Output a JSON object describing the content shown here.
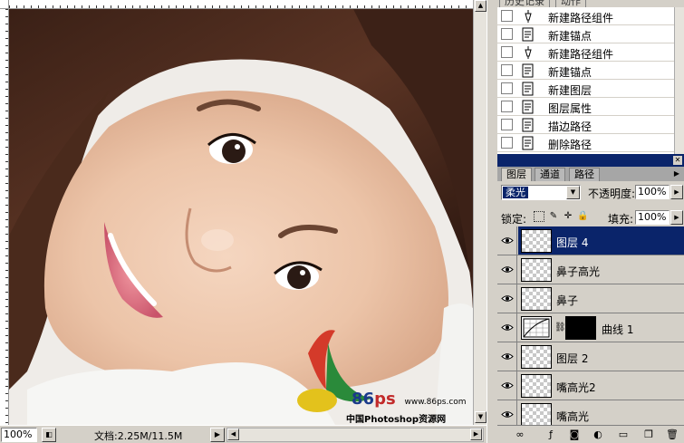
{
  "canvas": {
    "watermark": {
      "brand_number": "86",
      "brand_letters": "ps",
      "url": "www.86ps.com",
      "site_name": "中国Photoshop资源网"
    }
  },
  "statusbar": {
    "zoom": "100%",
    "doc_info": "文档:2.25M/11.5M"
  },
  "history_panel": {
    "tabs": [
      "历史记录",
      "动作"
    ],
    "items": [
      {
        "label": "新建路径组件",
        "icon": "pen-icon"
      },
      {
        "label": "新建锚点",
        "icon": "history-state-icon"
      },
      {
        "label": "新建路径组件",
        "icon": "pen-icon"
      },
      {
        "label": "新建锚点",
        "icon": "history-state-icon"
      },
      {
        "label": "新建图层",
        "icon": "history-state-icon"
      },
      {
        "label": "图层属性",
        "icon": "history-state-icon"
      },
      {
        "label": "描边路径",
        "icon": "history-state-icon"
      },
      {
        "label": "删除路径",
        "icon": "history-state-icon"
      }
    ]
  },
  "layers_panel": {
    "tabs": [
      "图层",
      "通道",
      "路径"
    ],
    "blend_mode": "柔光",
    "opacity_label": "不透明度:",
    "opacity_value": "100%",
    "lock_label": "锁定:",
    "fill_label": "填充:",
    "fill_value": "100%",
    "layers": [
      {
        "name": "图层 4",
        "type": "pixel",
        "selected": true
      },
      {
        "name": "鼻子高光",
        "type": "pixel",
        "selected": false
      },
      {
        "name": "鼻子",
        "type": "pixel",
        "selected": false
      },
      {
        "name": "曲线 1",
        "type": "adjustment",
        "selected": false
      },
      {
        "name": "图层 2",
        "type": "pixel",
        "selected": false
      },
      {
        "name": "嘴高光2",
        "type": "pixel",
        "selected": false
      },
      {
        "name": "嘴高光",
        "type": "pixel",
        "selected": false
      }
    ]
  },
  "colors": {
    "panel_bg": "#d4d0c8",
    "selection": "#0a246a",
    "titlebar": "#0a246a"
  }
}
